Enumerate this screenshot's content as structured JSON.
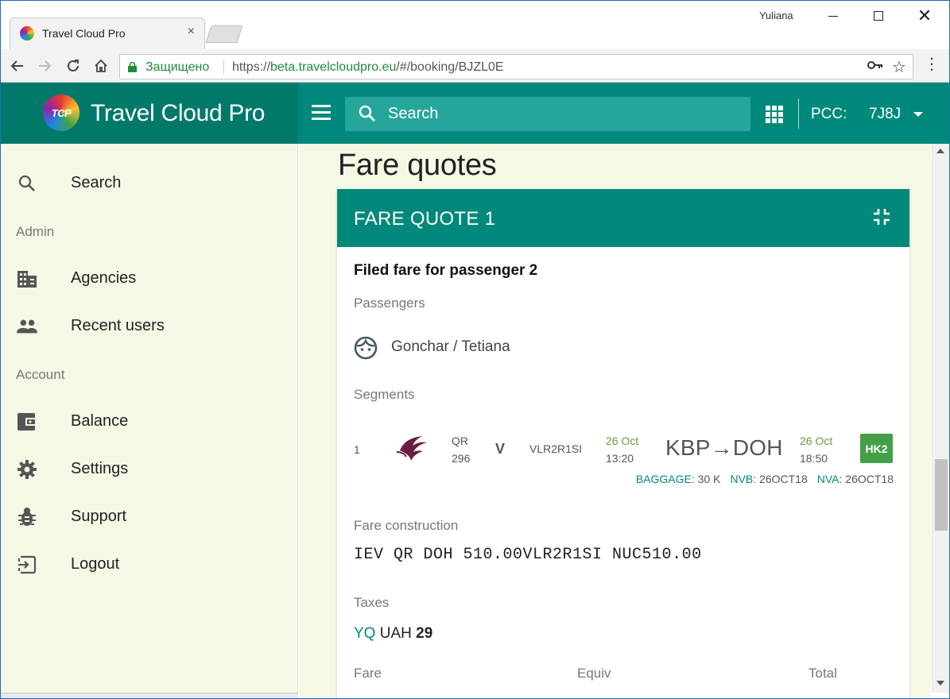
{
  "browser": {
    "tab_title": "Travel Cloud Pro",
    "tab_close": "×",
    "user": "Yuliana",
    "secure_label": "Защищено",
    "url_scheme": "https://",
    "url_host": "beta.travelcloudpro.eu",
    "url_path": "/#/booking/BJZL0E",
    "window_close": "✕"
  },
  "header": {
    "logo_text": "TCP",
    "brand": "Travel Cloud Pro",
    "search_placeholder": "Search",
    "pcc_label": "PCC:",
    "pcc_value": "7J8J"
  },
  "sidebar": {
    "items": [
      {
        "label": "Search",
        "icon": "search-icon"
      },
      {
        "label": "Agencies",
        "icon": "building-icon"
      },
      {
        "label": "Recent users",
        "icon": "people-icon"
      },
      {
        "label": "Balance",
        "icon": "wallet-icon"
      },
      {
        "label": "Settings",
        "icon": "gear-icon"
      },
      {
        "label": "Support",
        "icon": "bug-icon"
      },
      {
        "label": "Logout",
        "icon": "logout-icon"
      }
    ],
    "sections": {
      "admin": "Admin",
      "account": "Account"
    }
  },
  "main": {
    "page_title": "Fare quotes",
    "card": {
      "title": "FARE QUOTE 1",
      "filed_fare": "Filed fare for passenger 2",
      "passengers_label": "Passengers",
      "passenger_name": "Gonchar / Tetiana",
      "segments_label": "Segments",
      "segment": {
        "num": "1",
        "airline_code": "QR",
        "flight_no": "296",
        "booking_class": "V",
        "fare_basis": "VLR2R1SI",
        "dep_date": "26 Oct",
        "dep_time": "13:20",
        "route": "KBP→DOH",
        "arr_date": "26 Oct",
        "arr_time": "18:50",
        "status": "HK2",
        "baggage_label": "BAGGAGE:",
        "baggage_value": "30 K",
        "nvb_label": "NVB:",
        "nvb_value": "26OCT18",
        "nva_label": "NVA:",
        "nva_value": "26OCT18"
      },
      "fare_construction_label": "Fare construction",
      "fare_construction": "IEV QR DOH 510.00VLR2R1SI NUC510.00",
      "taxes_label": "Taxes",
      "tax_code": "YQ",
      "tax_currency": "UAH",
      "tax_amount": "29",
      "col_fare": "Fare",
      "col_equiv": "Equiv",
      "col_total": "Total"
    }
  },
  "colors": {
    "primary": "#00897b",
    "primary_dark": "#00796b",
    "sidebar_bg": "#f6f8e6",
    "status_green": "#43a047",
    "date_green": "#6d9a38"
  }
}
